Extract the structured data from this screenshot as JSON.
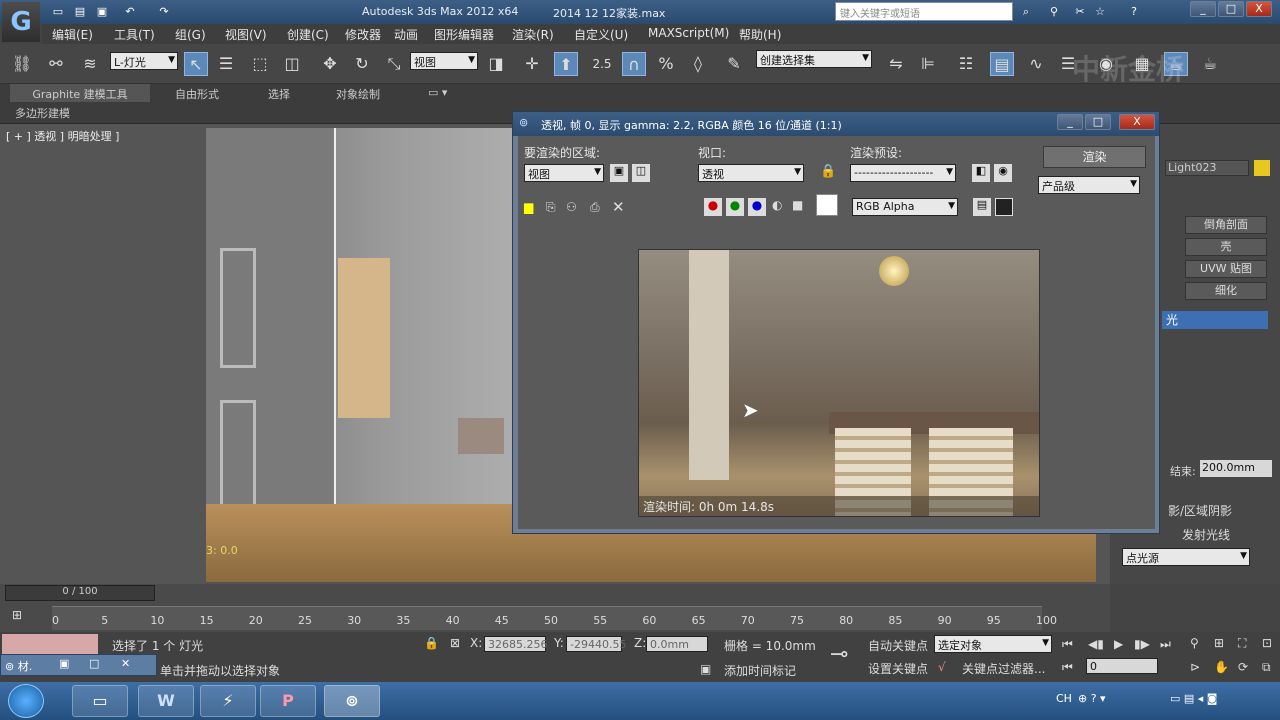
{
  "app": {
    "logo_glyph": "G",
    "title": "Autodesk 3ds Max  2012 x64",
    "file": "2014 12 12家装.max",
    "search_placeholder": "键入关键字或短语",
    "watermark": "中新金桥"
  },
  "window_controls": {
    "min": "_",
    "max": "□",
    "close": "X"
  },
  "menu": [
    "编辑(E)",
    "工具(T)",
    "组(G)",
    "视图(V)",
    "创建(C)",
    "修改器",
    "动画",
    "图形编辑器",
    "渲染(R)",
    "自定义(U)",
    "MAXScript(M)",
    "帮助(H)"
  ],
  "toolbar": {
    "selection_filter": "L-灯光",
    "ref_coord": "视图",
    "snap_value": "2.5",
    "named_set": "创建选择集"
  },
  "ribbon": {
    "tabs": [
      "Graphite 建模工具",
      "自由形式",
      "选择",
      "对象绘制"
    ],
    "sub": "多边形建模"
  },
  "viewport": {
    "label": "[ + ] 透视 ] 明暗处理 ]",
    "coord_text": "3: 0.0"
  },
  "render_window": {
    "title": "透视, 帧 0, 显示 gamma: 2.2, RGBA 颜色 16 位/通道 (1:1)",
    "area_label": "要渲染的区域:",
    "area_value": "视图",
    "viewport_label": "视口:",
    "viewport_value": "透视",
    "preset_label": "渲染预设:",
    "preset_value": "--------------------",
    "render_button": "渲染",
    "level_value": "产品级",
    "channel_value": "RGB Alpha",
    "render_time": "渲染时间: 0h 0m 14.8s"
  },
  "right_panel": {
    "name": "Light023",
    "buttons": [
      "倒角剖面",
      "壳",
      "UVW 贴图",
      "细化"
    ],
    "list_item": "光",
    "end_label": "结束:",
    "end_value": "200.0mm",
    "shadow": "影/区域阴影",
    "ray_label": "发射光线",
    "source": "点光源"
  },
  "timeline": {
    "frame": "0 / 100",
    "ticks": [
      "0",
      "5",
      "10",
      "15",
      "20",
      "25",
      "30",
      "35",
      "40",
      "45",
      "50",
      "55",
      "60",
      "65",
      "70",
      "75",
      "80",
      "85",
      "90",
      "95",
      "100"
    ]
  },
  "status": {
    "selected": "选择了 1 个 灯光",
    "hint": "单击并拖动以选择对象",
    "x_label": "X:",
    "x": "32685.256",
    "y_label": "Y:",
    "y": "-29440.55",
    "z_label": "Z:",
    "z": "0.0mm",
    "grid": "栅格 = 10.0mm",
    "auto_key": "自动关键点",
    "set_key": "设置关键点",
    "key_mode": "选定对象",
    "key_filter": "关键点过滤器...",
    "add_tag": "添加时间标记",
    "frame_field": "0",
    "mini_dialog": "材."
  },
  "taskbar": {
    "apps": [
      "folder",
      "Word",
      "Flash",
      "PowerPoint",
      "3ds Max"
    ],
    "lang": "CH"
  }
}
